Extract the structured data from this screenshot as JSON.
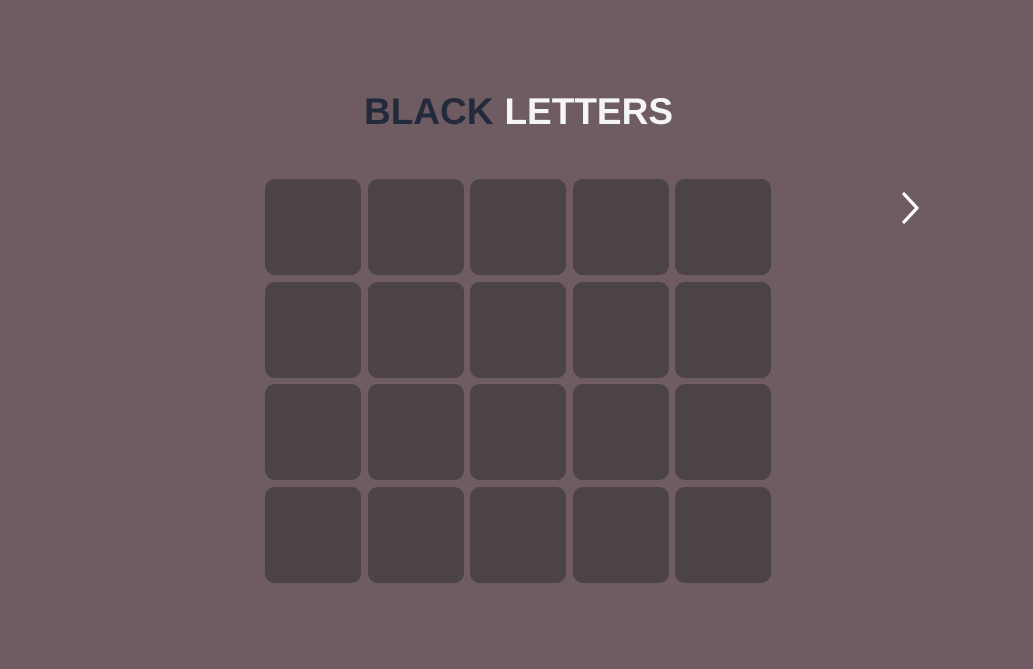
{
  "colors": {
    "background": "#6e5c62",
    "tile": "#4b4346",
    "title_dark": "#222a3b",
    "title_light": "#f5f4f6",
    "arrow": "#ffffff"
  },
  "header": {
    "title_word_dark": "BLACK",
    "title_word_light": "LETTERS"
  },
  "board": {
    "rows": 4,
    "columns": 5,
    "tiles": [
      "",
      "",
      "",
      "",
      "",
      "",
      "",
      "",
      "",
      "",
      "",
      "",
      "",
      "",
      "",
      "",
      "",
      "",
      "",
      ""
    ]
  },
  "navigation": {
    "next_icon": "chevron-right-icon"
  }
}
